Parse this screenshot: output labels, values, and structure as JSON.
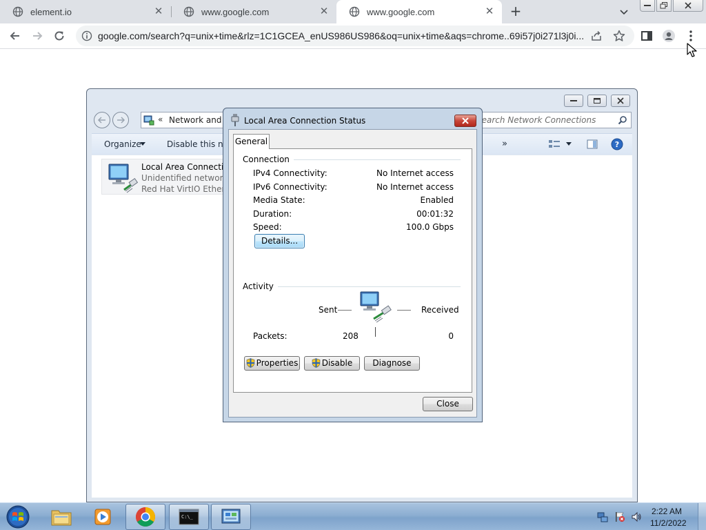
{
  "browser": {
    "tabs": [
      {
        "title": "element.io"
      },
      {
        "title": "www.google.com"
      },
      {
        "title": "www.google.com"
      }
    ],
    "url": "google.com/search?q=unix+time&rlz=1C1GCEA_enUS986US986&oq=unix+time&aqs=chrome..69i57j0i271l3j0i..."
  },
  "explorer": {
    "breadcrumb_chevron": "«",
    "breadcrumb": "Network and Internet",
    "search_placeholder": "Search Network Connections",
    "commands": {
      "organize": "Organize",
      "disable": "Disable this network device",
      "overflow": "»"
    },
    "connection": {
      "name": "Local Area Connection",
      "network": "Unidentified network",
      "device": "Red Hat VirtIO Ethernet Adapter"
    }
  },
  "dialog": {
    "title": "Local Area Connection Status",
    "tab": "General",
    "connection_group": "Connection",
    "rows": [
      {
        "label": "IPv4 Connectivity:",
        "value": "No Internet access"
      },
      {
        "label": "IPv6 Connectivity:",
        "value": "No Internet access"
      },
      {
        "label": "Media State:",
        "value": "Enabled"
      },
      {
        "label": "Duration:",
        "value": "00:01:32"
      },
      {
        "label": "Speed:",
        "value": "100.0 Gbps"
      }
    ],
    "details_button": "Details...",
    "activity_group": "Activity",
    "sent_label": "Sent",
    "received_label": "Received",
    "packets_label": "Packets:",
    "packets_sent": "208",
    "packets_received": "0",
    "properties_button": "Properties",
    "disable_button": "Disable",
    "diagnose_button": "Diagnose",
    "close_button": "Close"
  },
  "taskbar": {
    "time": "2:22 AM",
    "date": "11/2/2022"
  },
  "colors": {
    "chrome_tabstrip": "#dee1e6",
    "omnibox": "#f1f3f4",
    "win7_dialog_frame": "#c6d6e7",
    "win7_taskbar": "#8caed2"
  }
}
